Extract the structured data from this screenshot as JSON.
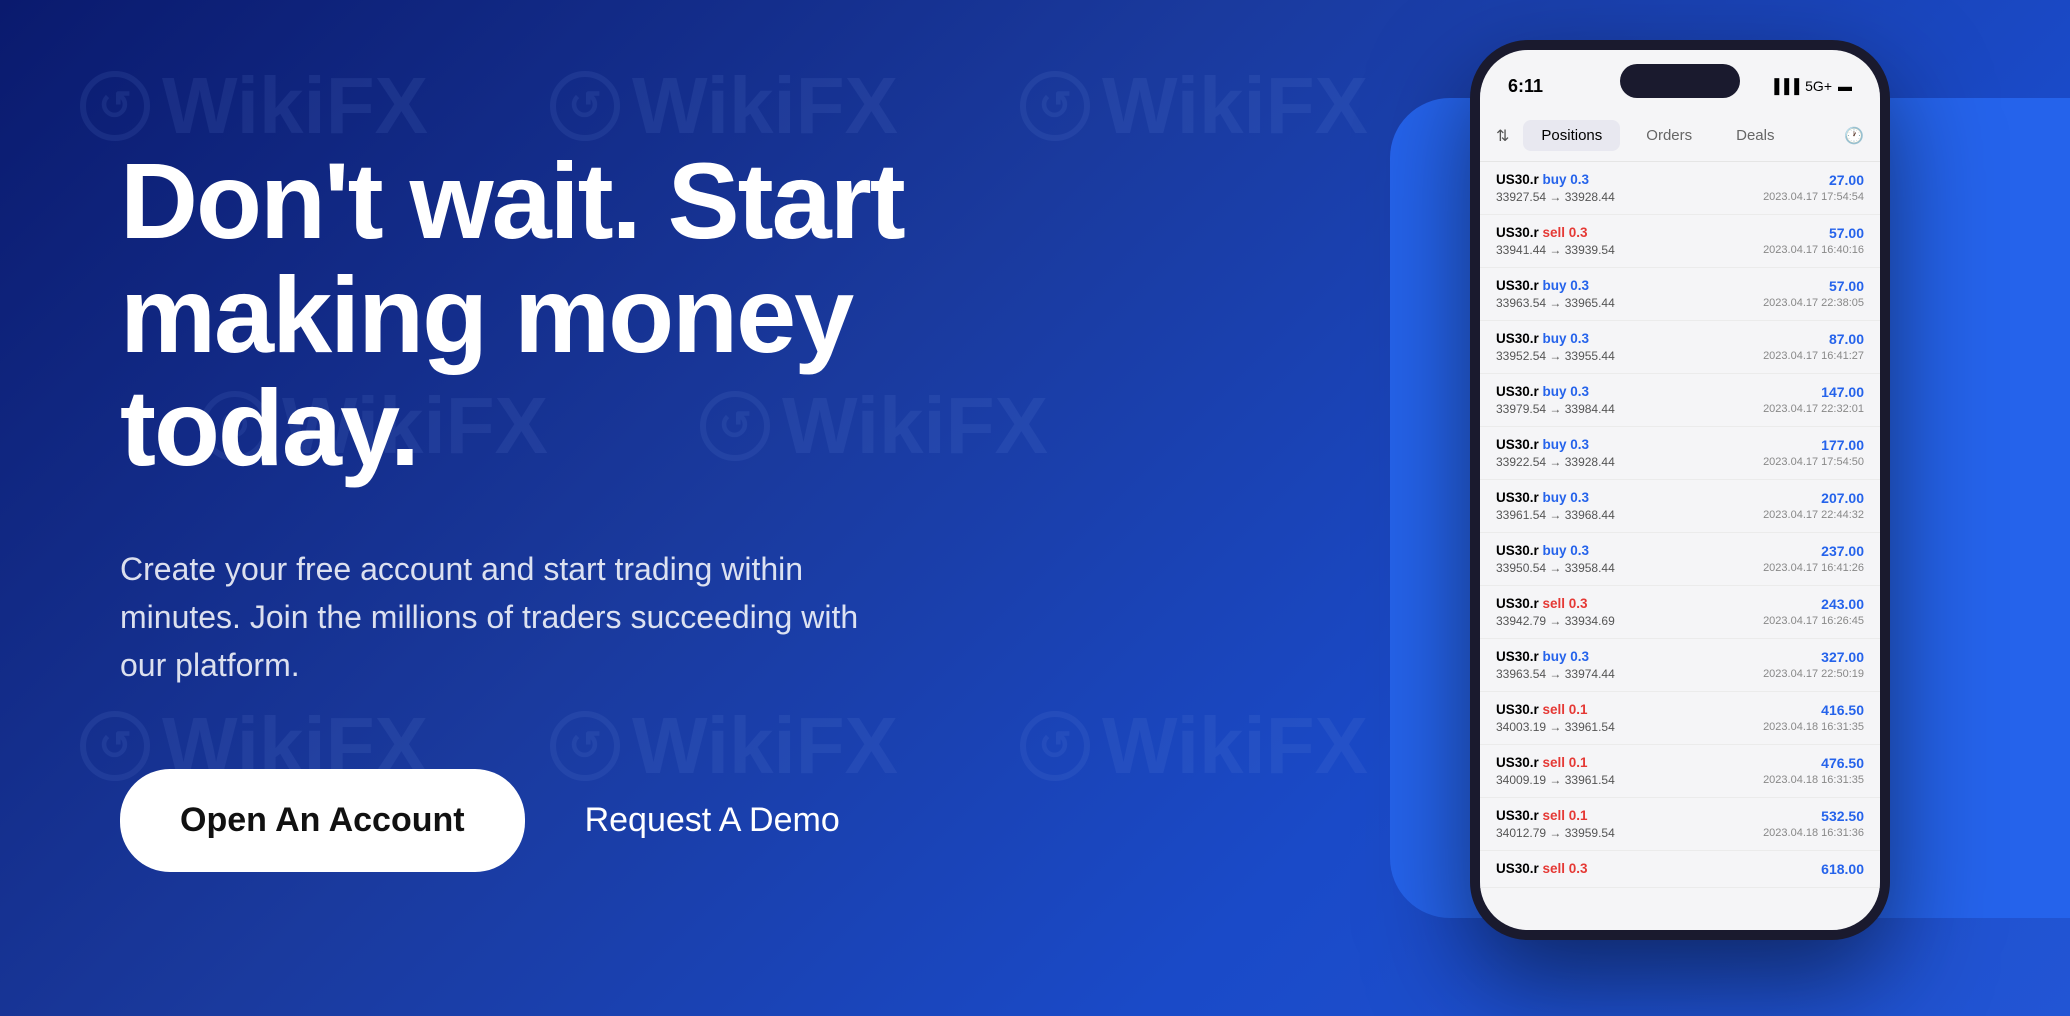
{
  "hero": {
    "headline": "Don't wait. Start\nmaking money today.",
    "subtext": "Create your free account and start trading within minutes. Join the millions of traders succeeding with our platform.",
    "btn_primary": "Open An Account",
    "btn_secondary": "Request A Demo",
    "brand": "WikiFX"
  },
  "phone": {
    "time": "6:11",
    "signal": "5G+",
    "tabs": [
      "Positions",
      "Orders",
      "Deals"
    ],
    "active_tab": "Deals"
  },
  "trades": [
    {
      "name": "US30.r",
      "action": "buy",
      "qty": "0.3",
      "from": "33927.54",
      "to": "33928.44",
      "profit": "27.00",
      "date": "2023.04.17 17:54:54"
    },
    {
      "name": "US30.r",
      "action": "sell",
      "qty": "0.3",
      "from": "33941.44",
      "to": "33939.54",
      "profit": "57.00",
      "date": "2023.04.17 16:40:16"
    },
    {
      "name": "US30.r",
      "action": "buy",
      "qty": "0.3",
      "from": "33963.54",
      "to": "33965.44",
      "profit": "57.00",
      "date": "2023.04.17 22:38:05"
    },
    {
      "name": "US30.r",
      "action": "buy",
      "qty": "0.3",
      "from": "33952.54",
      "to": "33955.44",
      "profit": "87.00",
      "date": "2023.04.17 16:41:27"
    },
    {
      "name": "US30.r",
      "action": "buy",
      "qty": "0.3",
      "from": "33979.54",
      "to": "33984.44",
      "profit": "147.00",
      "date": "2023.04.17 22:32:01"
    },
    {
      "name": "US30.r",
      "action": "buy",
      "qty": "0.3",
      "from": "33922.54",
      "to": "33928.44",
      "profit": "177.00",
      "date": "2023.04.17 17:54:50"
    },
    {
      "name": "US30.r",
      "action": "buy",
      "qty": "0.3",
      "from": "33961.54",
      "to": "33968.44",
      "profit": "207.00",
      "date": "2023.04.17 22:44:32"
    },
    {
      "name": "US30.r",
      "action": "buy",
      "qty": "0.3",
      "from": "33950.54",
      "to": "33958.44",
      "profit": "237.00",
      "date": "2023.04.17 16:41:26"
    },
    {
      "name": "US30.r",
      "action": "sell",
      "qty": "0.3",
      "from": "33942.79",
      "to": "33934.69",
      "profit": "243.00",
      "date": "2023.04.17 16:26:45"
    },
    {
      "name": "US30.r",
      "action": "buy",
      "qty": "0.3",
      "from": "33963.54",
      "to": "33974.44",
      "profit": "327.00",
      "date": "2023.04.17 22:50:19"
    },
    {
      "name": "US30.r",
      "action": "sell",
      "qty": "0.1",
      "from": "34003.19",
      "to": "33961.54",
      "profit": "416.50",
      "date": "2023.04.18 16:31:35"
    },
    {
      "name": "US30.r",
      "action": "sell",
      "qty": "0.1",
      "from": "34009.19",
      "to": "33961.54",
      "profit": "476.50",
      "date": "2023.04.18 16:31:35"
    },
    {
      "name": "US30.r",
      "action": "sell",
      "qty": "0.1",
      "from": "34012.79",
      "to": "33959.54",
      "profit": "532.50",
      "date": "2023.04.18 16:31:36"
    },
    {
      "name": "US30.r",
      "action": "sell",
      "qty": "0.3",
      "from": "",
      "to": "",
      "profit": "618.00",
      "date": ""
    }
  ]
}
